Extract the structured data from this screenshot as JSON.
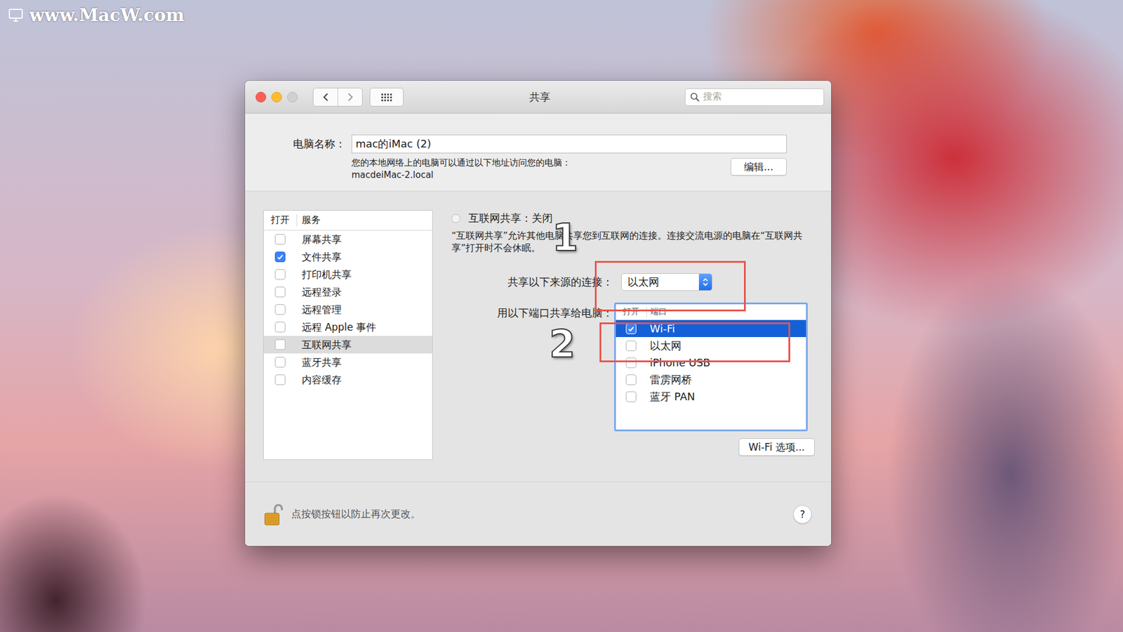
{
  "watermark": "www.MacW.com",
  "window": {
    "title": "共享"
  },
  "search": {
    "placeholder": "搜索"
  },
  "computer_name": {
    "label": "电脑名称：",
    "value": "mac的iMac (2)",
    "hint": "您的本地网络上的电脑可以通过以下地址访问您的电脑：",
    "address": "macdeiMac-2.local",
    "edit_button": "编辑..."
  },
  "services": {
    "columns": [
      "打开",
      "服务"
    ],
    "items": [
      {
        "label": "屏幕共享",
        "checked": false,
        "selected": false
      },
      {
        "label": "文件共享",
        "checked": true,
        "selected": false
      },
      {
        "label": "打印机共享",
        "checked": false,
        "selected": false
      },
      {
        "label": "远程登录",
        "checked": false,
        "selected": false
      },
      {
        "label": "远程管理",
        "checked": false,
        "selected": false
      },
      {
        "label": "远程 Apple 事件",
        "checked": false,
        "selected": false
      },
      {
        "label": "互联网共享",
        "checked": false,
        "selected": true
      },
      {
        "label": "蓝牙共享",
        "checked": false,
        "selected": false
      },
      {
        "label": "内容缓存",
        "checked": false,
        "selected": false
      }
    ]
  },
  "internet_sharing": {
    "status": "互联网共享：关闭",
    "on": false,
    "description": "“互联网共享”允许其他电脑共享您到互联网的连接。连接交流电源的电脑在“互联网共享”打开时不会休眠。",
    "share_from_label": "共享以下来源的连接：",
    "share_from_value": "以太网",
    "ports_label": "用以下端口共享给电脑：",
    "ports_columns": [
      "打开",
      "端口"
    ],
    "ports": [
      {
        "label": "Wi-Fi",
        "checked": true,
        "selected": true
      },
      {
        "label": "以太网",
        "checked": false,
        "selected": false
      },
      {
        "label": "iPhone USB",
        "checked": false,
        "selected": false
      },
      {
        "label": "雷雳网桥",
        "checked": false,
        "selected": false
      },
      {
        "label": "蓝牙 PAN",
        "checked": false,
        "selected": false
      }
    ],
    "wifi_options_button": "Wi-Fi 选项..."
  },
  "footer": {
    "lock_text": "点按锁按钮以防止再次更改。",
    "locked": false,
    "help": "?"
  },
  "annotations": [
    {
      "label": "1"
    },
    {
      "label": "2"
    }
  ]
}
